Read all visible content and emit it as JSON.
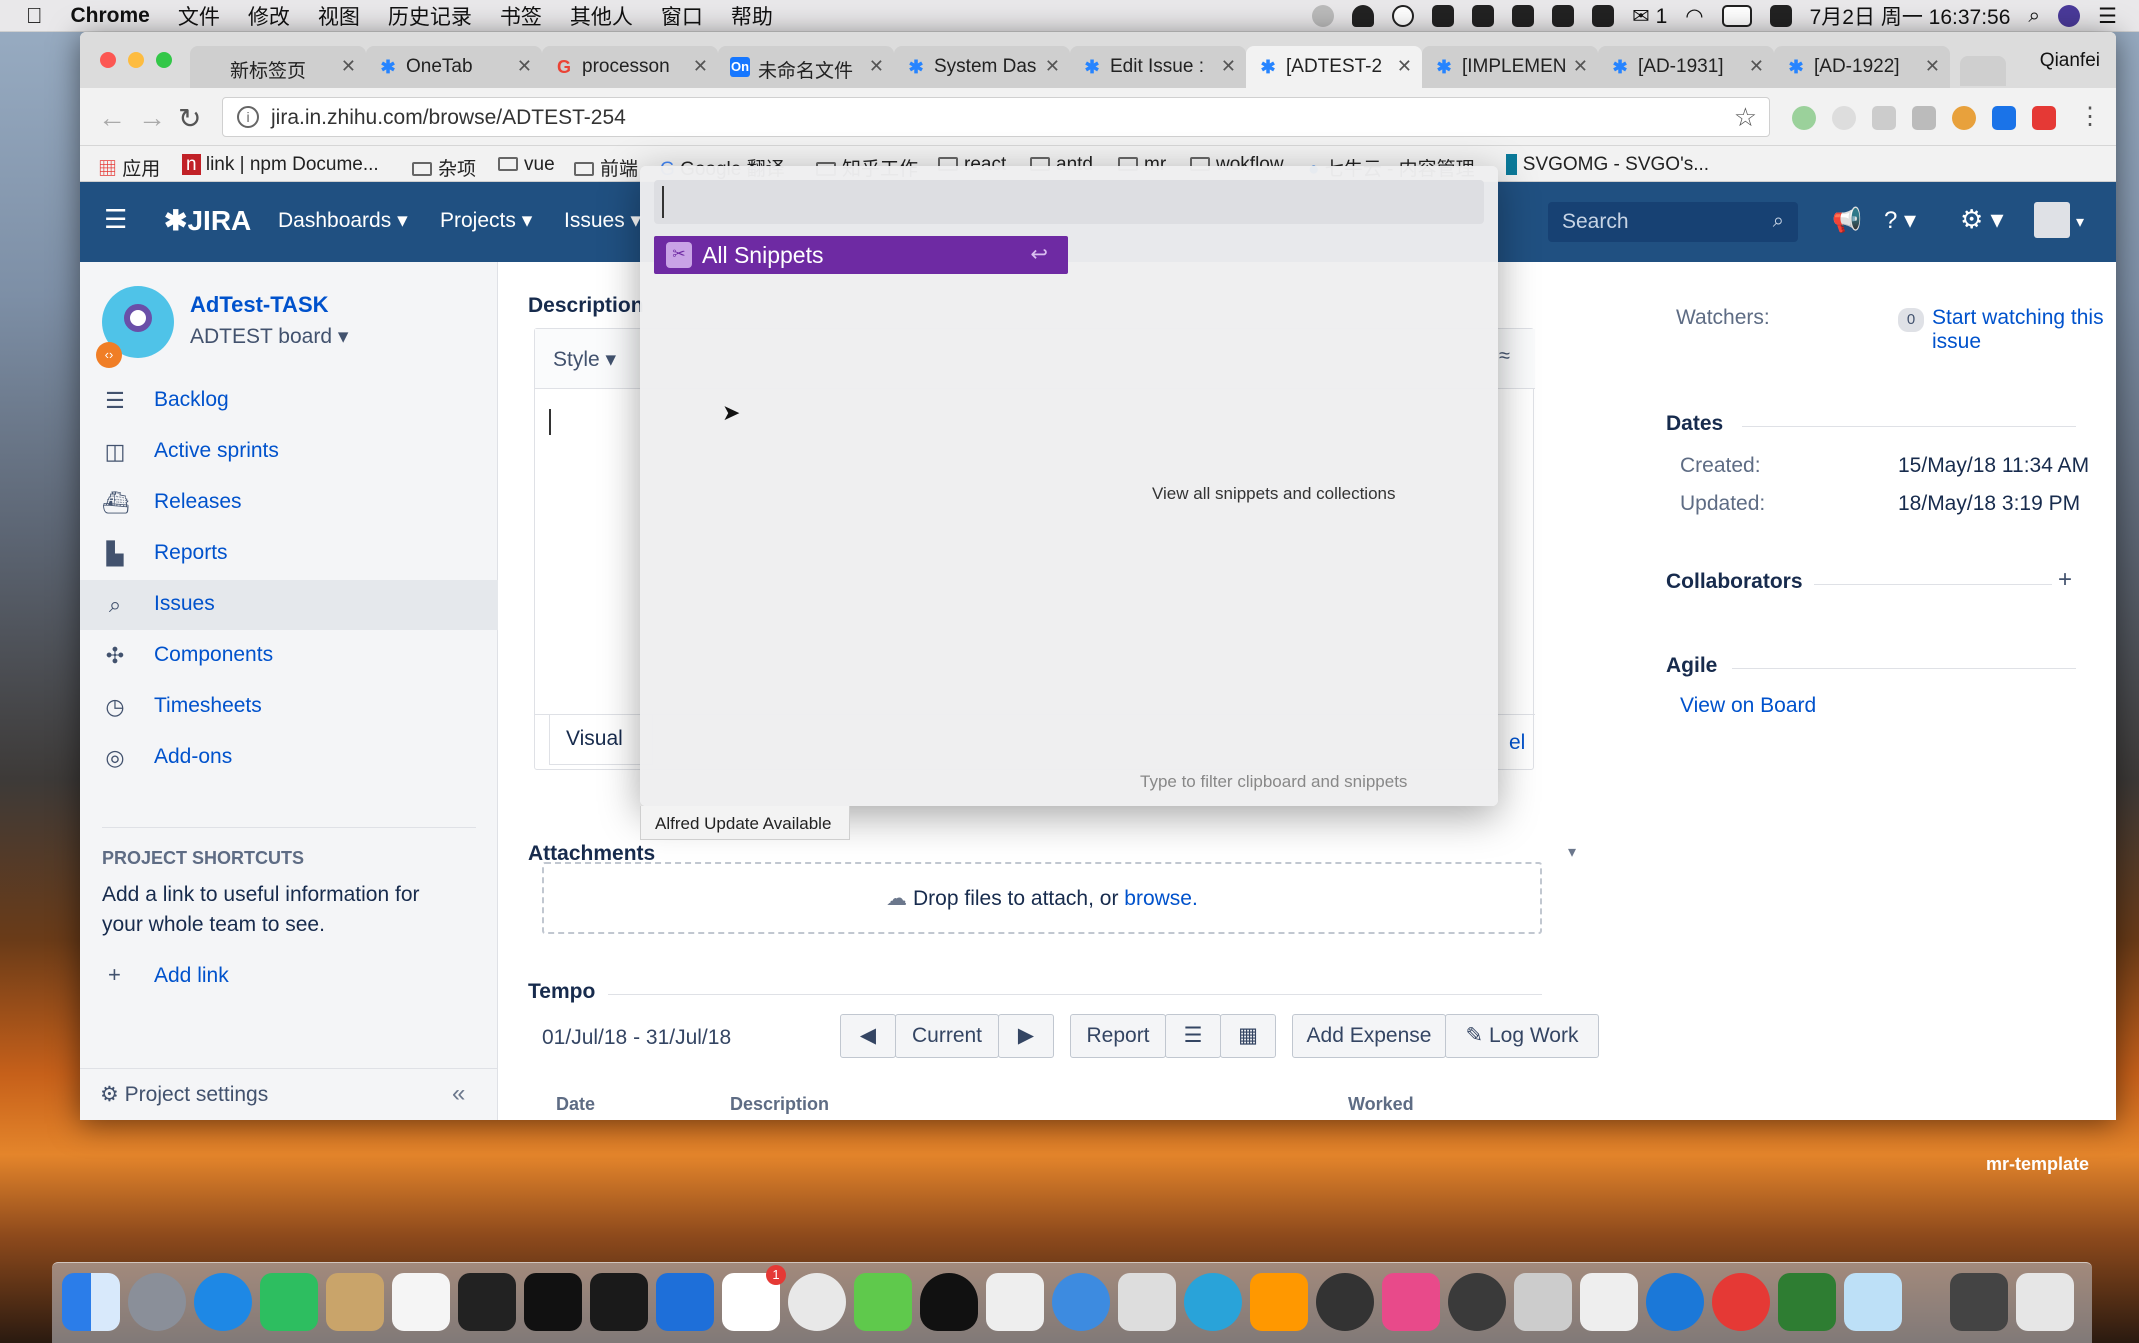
{
  "menubar": {
    "apple": "",
    "app": "Chrome",
    "items": [
      "文件",
      "修改",
      "视图",
      "历史记录",
      "书签",
      "其他人",
      "窗口",
      "帮助"
    ],
    "wechat_count": "1",
    "datetime": "7月2日 周一  16:37:56"
  },
  "tabs": [
    {
      "label": "新标签页",
      "icon": "newtab-icon"
    },
    {
      "label": "OneTab",
      "icon": "jira-icon"
    },
    {
      "label": "processon",
      "icon": "google-icon"
    },
    {
      "label": "未命名文件",
      "icon": "processon-icon"
    },
    {
      "label": "System Das",
      "icon": "jira-icon"
    },
    {
      "label": "Edit Issue :",
      "icon": "jira-icon"
    },
    {
      "label": "[ADTEST-2",
      "icon": "jira-icon"
    },
    {
      "label": "[IMPLEMEN",
      "icon": "jira-icon"
    },
    {
      "label": "[AD-1931]",
      "icon": "jira-icon"
    },
    {
      "label": "[AD-1922]",
      "icon": "jira-icon"
    }
  ],
  "profile": "Qianfei",
  "address": "jira.in.zhihu.com/browse/ADTEST-254",
  "bookmarks": [
    "应用",
    "link | npm Docume...",
    "杂项",
    "vue",
    "前端",
    "Google 翻译",
    "知乎工作",
    "react",
    "antd",
    "mr",
    "wokflow",
    "七牛云 - 内容管理",
    "SVGOMG - SVGO's..."
  ],
  "jira": {
    "logo": "JIRA",
    "nav": [
      "Dashboards ▾",
      "Projects ▾",
      "Issues ▾"
    ],
    "search_placeholder": "Search",
    "project_name": "AdTest-TASK",
    "board": "ADTEST board ▾",
    "sidebar": [
      {
        "label": "Backlog",
        "icon": "backlog-icon"
      },
      {
        "label": "Active sprints",
        "icon": "board-icon"
      },
      {
        "label": "Releases",
        "icon": "ship-icon"
      },
      {
        "label": "Reports",
        "icon": "chart-icon"
      },
      {
        "label": "Issues",
        "icon": "issues-icon"
      },
      {
        "label": "Components",
        "icon": "puzzle-icon"
      },
      {
        "label": "Timesheets",
        "icon": "clock-icon"
      },
      {
        "label": "Add-ons",
        "icon": "addon-icon"
      }
    ],
    "shortcuts_title": "PROJECT SHORTCUTS",
    "shortcuts_text": "Add a link to useful information for your whole team to see.",
    "add_link": "Add link",
    "project_settings": "Project settings",
    "description_title": "Description",
    "style_btn": "Style ▾",
    "visual_tab": "Visual",
    "cancel_partial": "el",
    "attachments_title": "Attachments",
    "drop_text": "Drop files to attach, or ",
    "browse": "browse.",
    "tempo_title": "Tempo",
    "tempo_range": "01/Jul/18 - 31/Jul/18",
    "tempo_current": "Current",
    "tempo_report": "Report",
    "tempo_add_expense": "Add Expense",
    "tempo_log_work": "Log Work",
    "table_headers": [
      "Date",
      "Description",
      "Worked"
    ],
    "watchers_label": "Watchers:",
    "watchers_count": "0",
    "watch_link": "Start watching this issue",
    "dates_title": "Dates",
    "created_label": "Created:",
    "created_val": "15/May/18 11:34 AM",
    "updated_label": "Updated:",
    "updated_val": "18/May/18 3:19 PM",
    "collaborators_title": "Collaborators",
    "agile_title": "Agile",
    "view_board": "View on Board"
  },
  "alfred": {
    "selected": "All Snippets",
    "view_all": "View all snippets and collections",
    "hint": "Type to filter clipboard and snippets",
    "update": "Alfred Update Available"
  },
  "desktop_label": "mr-template",
  "dock_badge_1": "1"
}
